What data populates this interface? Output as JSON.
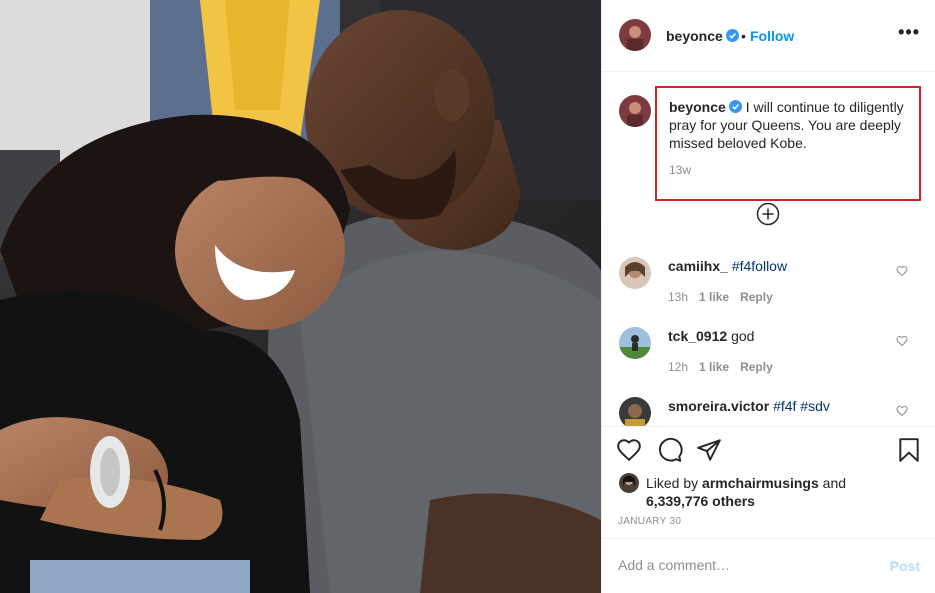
{
  "post": {
    "author": "beyonce",
    "follow_label": "Follow",
    "separator": "•",
    "more_label": "•••",
    "colors": {
      "accent": "#0095f6",
      "highlight_border": "#c8262a",
      "muted": "#8e8e8e"
    }
  },
  "caption": {
    "username": "beyonce",
    "text": "I will continue to diligently pray for your Queens. You are deeply missed beloved Kobe.",
    "time": "13w"
  },
  "comments": [
    {
      "username": "camiihx_",
      "text": "#f4follow",
      "time": "13h",
      "likes": "1 like",
      "reply": "Reply"
    },
    {
      "username": "tck_0912",
      "text": "god",
      "time": "12h",
      "likes": "1 like",
      "reply": "Reply"
    },
    {
      "username": "smoreira.victor",
      "text": "#f4f #sdv",
      "time": "",
      "likes": "",
      "reply": ""
    }
  ],
  "likes": {
    "prefix": "Liked by",
    "user": "armchairmusings",
    "and": "and",
    "others": "6,339,776 others"
  },
  "date": "JANUARY 30",
  "comment_box": {
    "placeholder": "Add a comment…",
    "post_label": "Post"
  },
  "icons": [
    "verified-badge-icon",
    "more-options-icon",
    "load-more-comments-icon",
    "heart-icon",
    "comment-icon",
    "share-icon",
    "bookmark-icon"
  ]
}
